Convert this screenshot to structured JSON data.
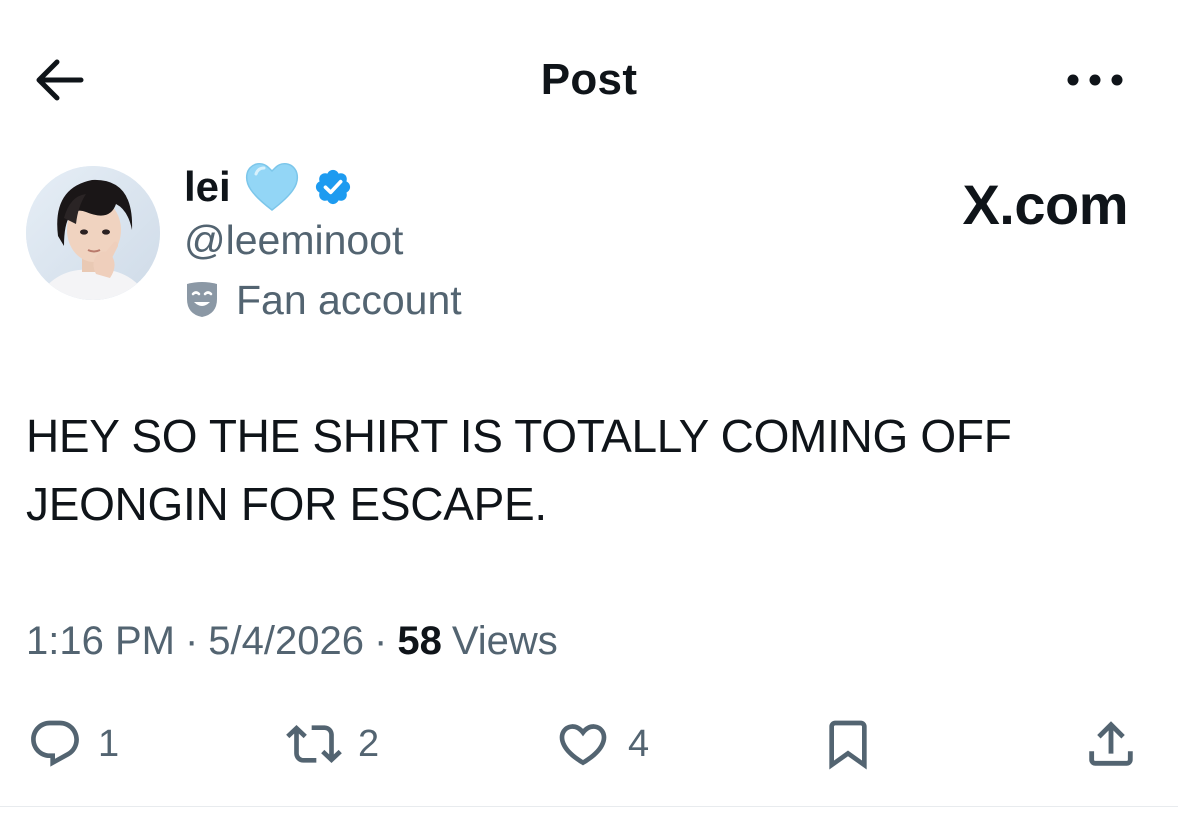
{
  "header": {
    "title": "Post",
    "back_icon": "arrow-left-icon",
    "more_icon": "more-horizontal-icon"
  },
  "author": {
    "display_name": "lei",
    "handle": "@leeminoot",
    "affiliation": "Fan account",
    "name_emoji": "light-blue-heart-icon",
    "verified_icon": "verified-badge-icon",
    "affiliation_icon": "theater-mask-icon",
    "colors": {
      "heart": "#8fd3f5",
      "verified": "#1d9bf0",
      "secondary_text": "#536471"
    }
  },
  "watermark": "X.com",
  "post": {
    "text": "HEY SO THE SHIRT IS TOTALLY COMING OFF JEONGIN FOR ESCAPE."
  },
  "meta": {
    "time": "1:16 PM",
    "separator": "·",
    "date": "5/4/2026",
    "views_count": "58",
    "views_label": "Views"
  },
  "actions": {
    "reply": {
      "icon": "reply-icon",
      "count": "1"
    },
    "repost": {
      "icon": "repost-icon",
      "count": "2"
    },
    "like": {
      "icon": "heart-icon",
      "count": "4"
    },
    "bookmark": {
      "icon": "bookmark-icon"
    },
    "share": {
      "icon": "share-icon"
    }
  }
}
